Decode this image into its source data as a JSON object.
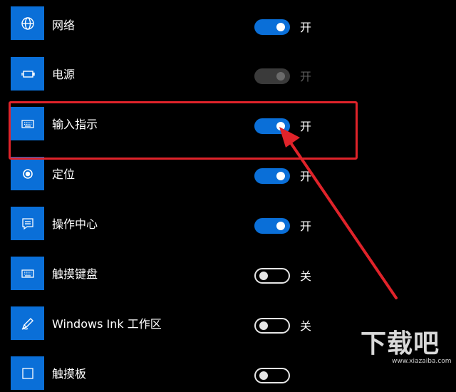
{
  "settings": [
    {
      "label": "网络",
      "icon": "globe-icon",
      "state": "on",
      "state_text": "开"
    },
    {
      "label": "电源",
      "icon": "battery-plug-icon",
      "state": "disabled",
      "state_text": "开"
    },
    {
      "label": "输入指示",
      "icon": "keyboard-icon",
      "state": "on",
      "state_text": "开"
    },
    {
      "label": "定位",
      "icon": "location-icon",
      "state": "on",
      "state_text": "开"
    },
    {
      "label": "操作中心",
      "icon": "action-center-icon",
      "state": "on",
      "state_text": "开"
    },
    {
      "label": "触摸键盘",
      "icon": "touch-keyboard-icon",
      "state": "off",
      "state_text": "关"
    },
    {
      "label": "Windows Ink 工作区",
      "icon": "pen-icon",
      "state": "off",
      "state_text": "关"
    },
    {
      "label": "触摸板",
      "icon": "touchpad-icon",
      "state": "off",
      "state_text": ""
    }
  ],
  "annotation": {
    "highlighted_item": "输入指示",
    "color": "#e0232a"
  },
  "colors": {
    "accent": "#0a6fd8",
    "background": "#000000",
    "annotation": "#e0232a"
  },
  "watermark": {
    "text": "下载吧",
    "url": "www.xiazaiba.com"
  }
}
